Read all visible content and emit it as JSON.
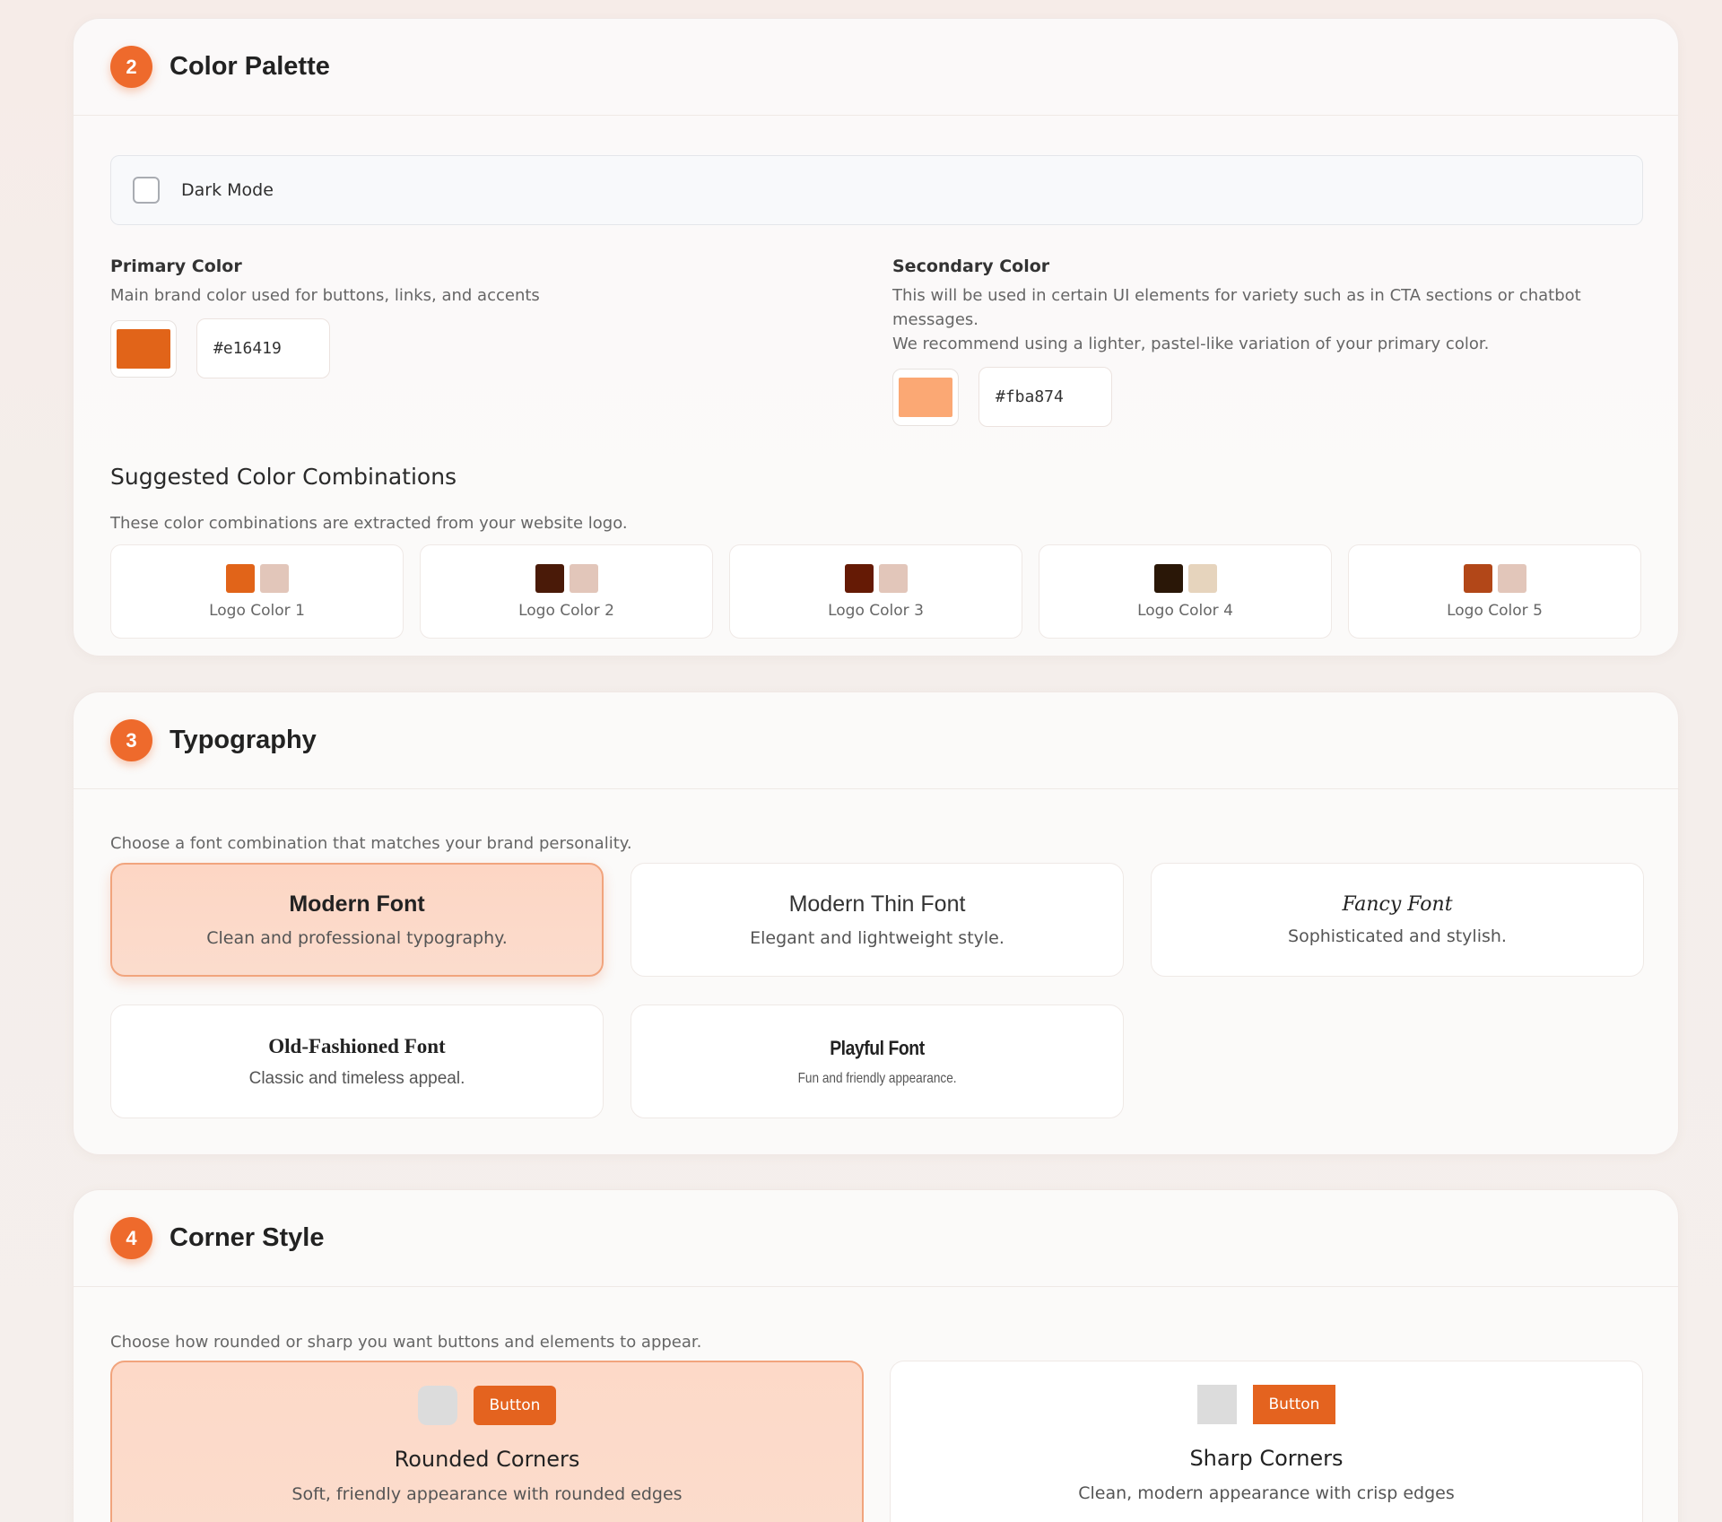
{
  "sections": {
    "palette": {
      "number": "2",
      "title": "Color Palette"
    },
    "typography": {
      "number": "3",
      "title": "Typography"
    },
    "corners": {
      "number": "4",
      "title": "Corner Style"
    }
  },
  "palette": {
    "dark_mode_label": "Dark Mode",
    "dark_mode_checked": false,
    "primary": {
      "label": "Primary Color",
      "description": "Main brand color used for buttons, links, and accents",
      "hex": "#e16419"
    },
    "secondary": {
      "label": "Secondary Color",
      "description_line1": "This will be used in certain UI elements for variety such as in CTA sections or chatbot messages.",
      "description_line2": "We recommend using a lighter, pastel-like variation of your primary color.",
      "hex": "#fba874"
    },
    "suggested_title": "Suggested Color Combinations",
    "suggested_desc": "These color combinations are extracted from your website logo.",
    "combos": [
      {
        "label": "Logo Color 1",
        "color_a": "#e16419",
        "color_b": "#e2c6ba"
      },
      {
        "label": "Logo Color 2",
        "color_a": "#4a1a08",
        "color_b": "#e2c6ba"
      },
      {
        "label": "Logo Color 3",
        "color_a": "#651a05",
        "color_b": "#e2c6ba"
      },
      {
        "label": "Logo Color 4",
        "color_a": "#2a1707",
        "color_b": "#e6d4bd"
      },
      {
        "label": "Logo Color 5",
        "color_a": "#b24718",
        "color_b": "#e2c6ba"
      }
    ]
  },
  "typography": {
    "description": "Choose a font combination that matches your brand personality.",
    "fonts": [
      {
        "name": "Modern Font",
        "desc": "Clean and professional typography.",
        "selected": true
      },
      {
        "name": "Modern Thin Font",
        "desc": "Elegant and lightweight style.",
        "selected": false
      },
      {
        "name": "Fancy Font",
        "desc": "Sophisticated and stylish.",
        "selected": false
      },
      {
        "name": "Old-Fashioned Font",
        "desc": "Classic and timeless appeal.",
        "selected": false
      },
      {
        "name": "Playful Font",
        "desc": "Fun and friendly appearance.",
        "selected": false
      }
    ]
  },
  "corners": {
    "description": "Choose how rounded or sharp you want buttons and elements to appear.",
    "options": [
      {
        "name": "Rounded Corners",
        "desc": "Soft, friendly appearance with rounded edges",
        "button": "Button",
        "selected": true
      },
      {
        "name": "Sharp Corners",
        "desc": "Clean, modern appearance with crisp edges",
        "button": "Button",
        "selected": false
      }
    ]
  },
  "colors": {
    "accent": "#ee6a2c",
    "button": "#e4631f"
  }
}
